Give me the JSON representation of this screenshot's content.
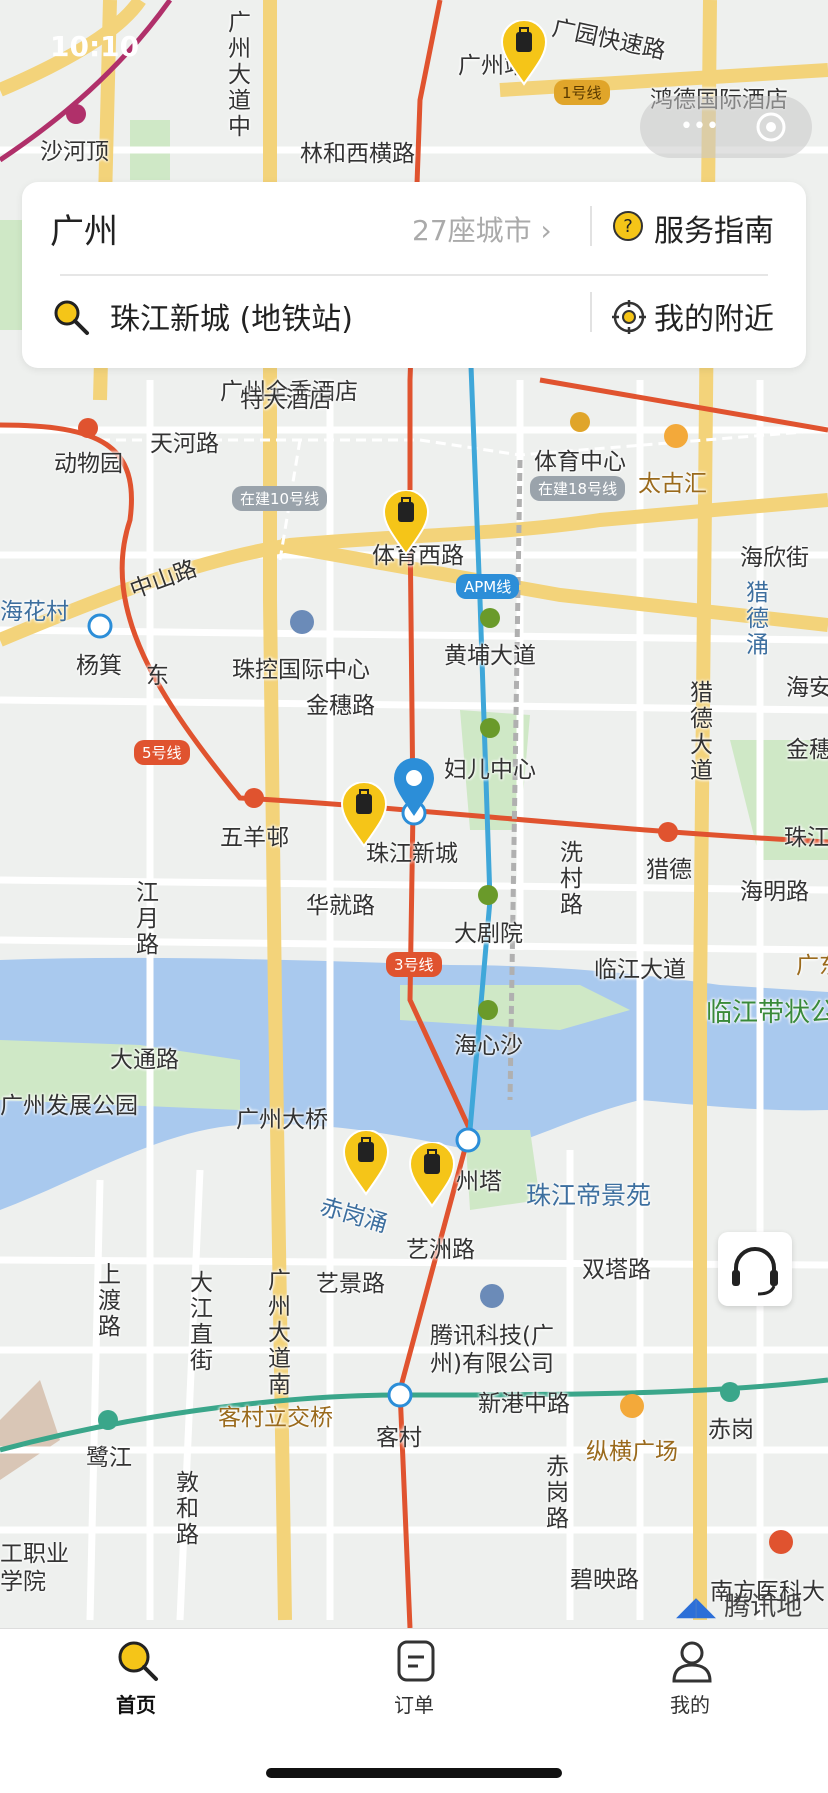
{
  "status_bar": {
    "time": "10:10"
  },
  "search_panel": {
    "city": "广州",
    "city_count": "27座城市",
    "guide_label": "服务指南",
    "location": "珠江新城 (地铁站)",
    "nearby_label": "我的附近"
  },
  "map": {
    "places": [
      "沙河顶",
      "林和西横路",
      "鸿德国际酒店",
      "广州站",
      "动物园",
      "天河路",
      "体育中心",
      "太古汇",
      "体育西路",
      "海花村",
      "杨箕",
      "中山路",
      "珠控国际中心",
      "黄埔大道",
      "金穗路",
      "海欣街",
      "猎德涌",
      "妇儿中心",
      "五羊邨",
      "珠江新城",
      "猎德",
      "华就路",
      "大剧院",
      "洗村路",
      "海明路",
      "江月路",
      "临江大道",
      "海心沙",
      "临江带状公",
      "大通路",
      "广州发展公园",
      "广州大桥",
      "州塔",
      "珠江帝景苑",
      "赤岗涌",
      "艺洲路",
      "双塔路",
      "艺景路",
      "上渡路",
      "大江直街",
      "广州大道南",
      "腾讯科技(广州)有限公司",
      "客村立交桥",
      "客村",
      "新港中路",
      "赤岗",
      "鹭江",
      "纵横广场",
      "赤岗路",
      "敦和路",
      "碧映路",
      "工职业学院",
      "南方医科大",
      "广州大道中",
      "广州全季酒店",
      "特大酒店",
      "海安",
      "金穗",
      "珠江",
      "广东",
      "猎德大道",
      "东",
      "广园快速路"
    ],
    "line_badges": [
      "1号线",
      "在建10号线",
      "在建18号线",
      "APM线",
      "5号线",
      "3号线"
    ],
    "map_logo": "腾讯地图"
  },
  "tabbar": {
    "tabs": [
      {
        "label": "首页",
        "icon": "search-icon",
        "active": true
      },
      {
        "label": "订单",
        "icon": "order-icon",
        "active": false
      },
      {
        "label": "我的",
        "icon": "user-icon",
        "active": false
      }
    ]
  },
  "colors": {
    "accent": "#f5c518",
    "metro_red": "#e0532f",
    "river": "#a9c9ee"
  }
}
